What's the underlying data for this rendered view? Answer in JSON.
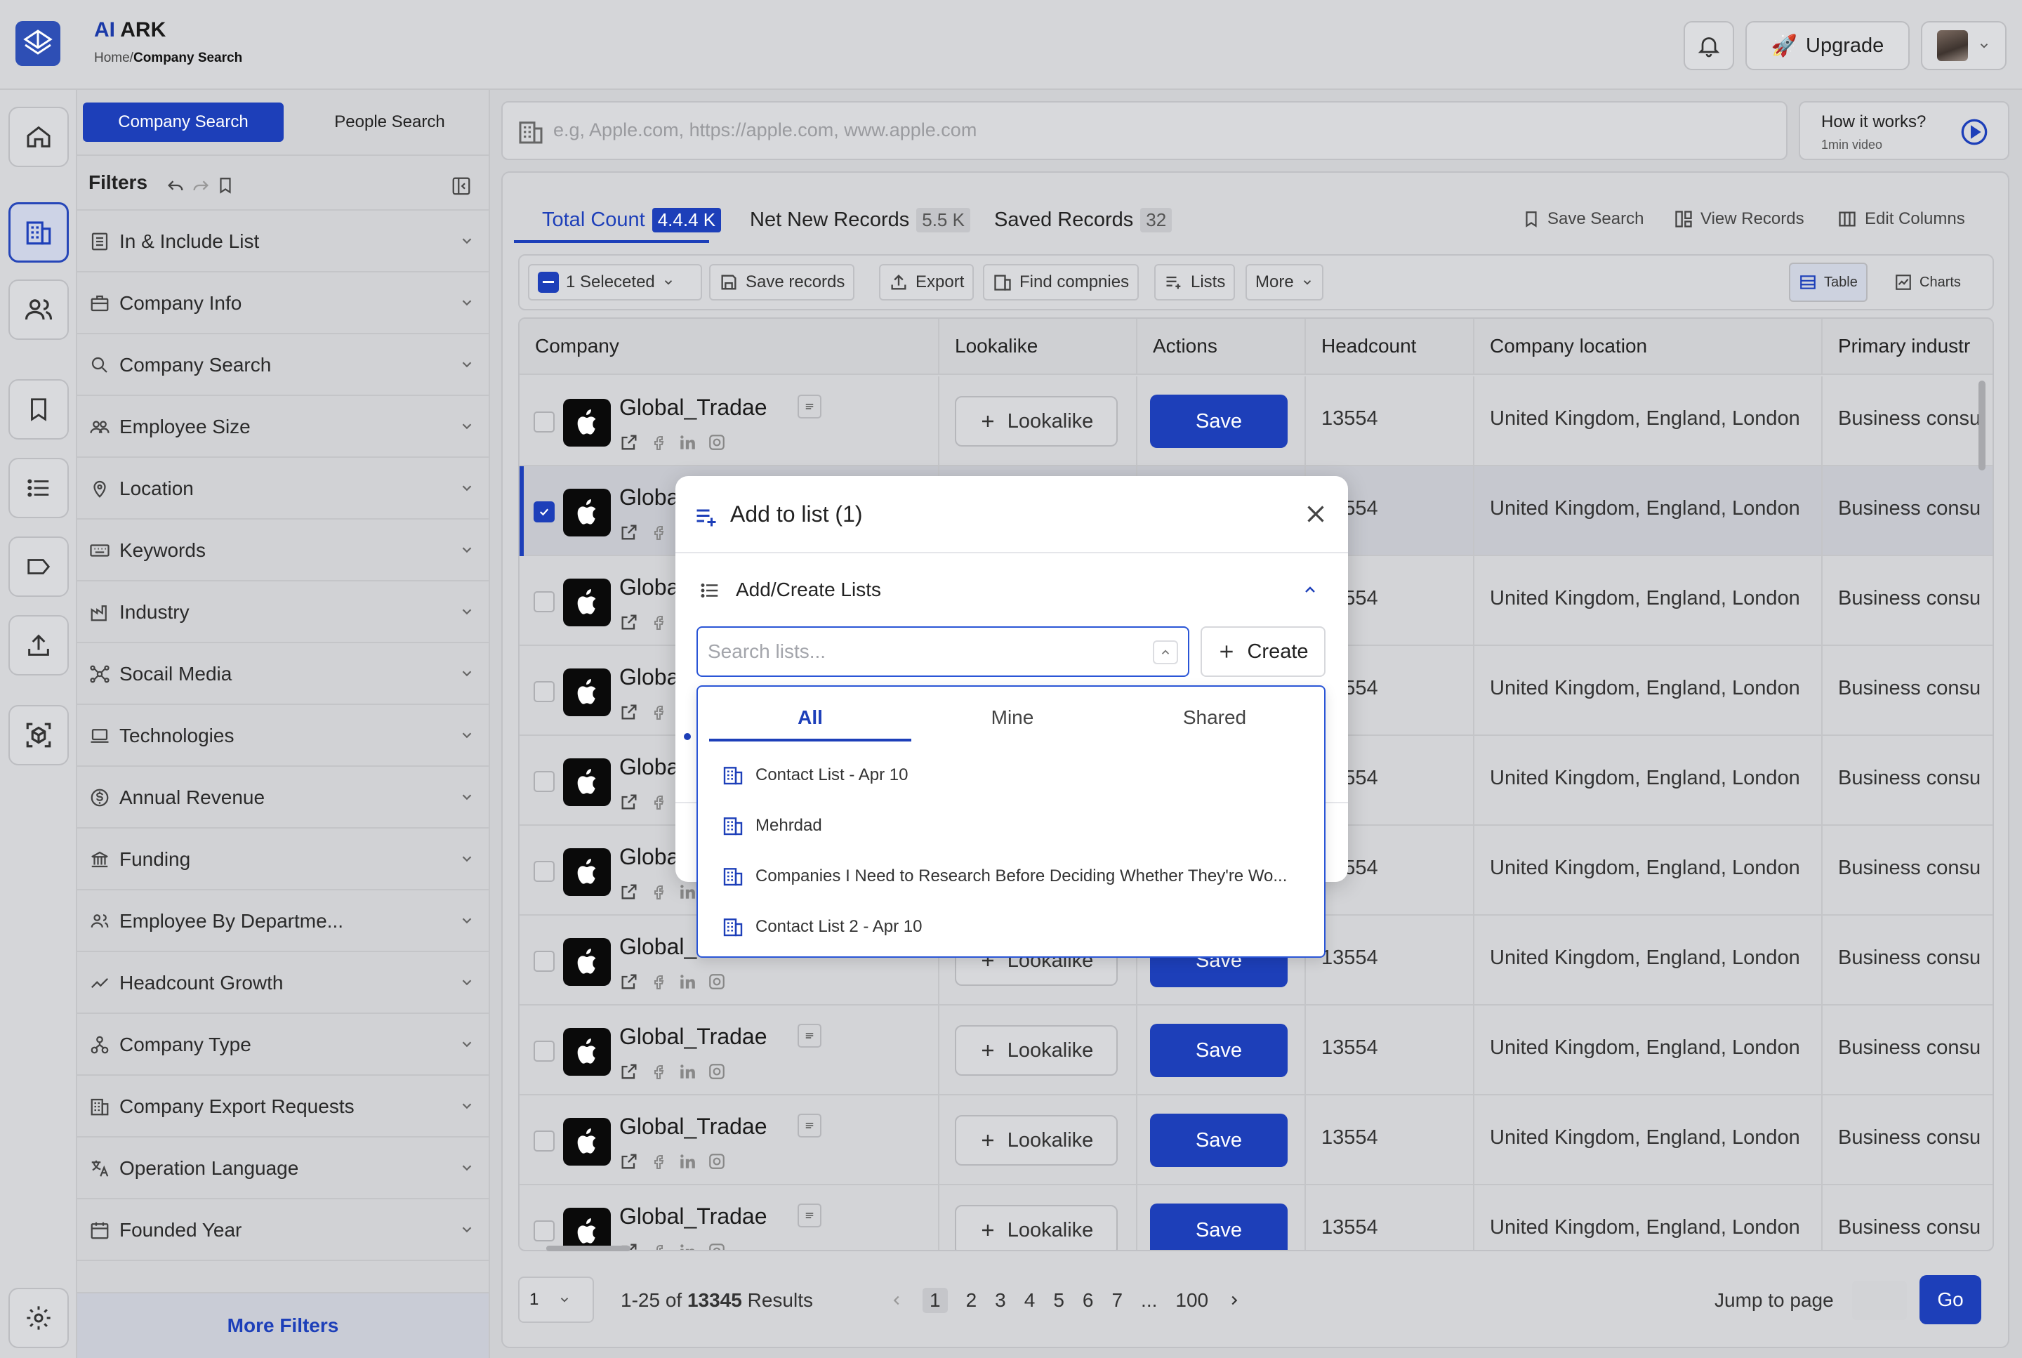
{
  "app": {
    "brand_ai": "AI",
    "brand_rest": "ARK"
  },
  "breadcrumb": {
    "home": "Home/",
    "current": "Company Search"
  },
  "header": {
    "upgrade_label": "Upgrade"
  },
  "search_tabs": {
    "company": "Company Search",
    "people": "People Search"
  },
  "filters": {
    "title": "Filters",
    "items": [
      {
        "label": "In & Include List",
        "icon": "list-icon"
      },
      {
        "label": "Company Info",
        "icon": "briefcase-icon"
      },
      {
        "label": "Company Search",
        "icon": "search-icon"
      },
      {
        "label": "Employee Size",
        "icon": "people-icon"
      },
      {
        "label": "Location",
        "icon": "pin-icon"
      },
      {
        "label": "Keywords",
        "icon": "keyboard-icon"
      },
      {
        "label": "Industry",
        "icon": "factory-icon"
      },
      {
        "label": "Socail Media",
        "icon": "network-icon"
      },
      {
        "label": "Technologies",
        "icon": "laptop-icon"
      },
      {
        "label": "Annual Revenue",
        "icon": "dollar-icon"
      },
      {
        "label": "Funding",
        "icon": "bank-icon"
      },
      {
        "label": "Employee By Departme...",
        "icon": "team-icon"
      },
      {
        "label": "Headcount Growth",
        "icon": "trend-icon"
      },
      {
        "label": "Company Type",
        "icon": "hierarchy-icon"
      },
      {
        "label": "Company Export Requests",
        "icon": "building-icon"
      },
      {
        "label": "Operation Language",
        "icon": "translate-icon"
      },
      {
        "label": "Founded Year",
        "icon": "calendar-icon"
      }
    ],
    "more_label": "More Filters"
  },
  "search": {
    "placeholder": "e.g, Apple.com, https://apple.com, www.apple.com",
    "how_title": "How it works?",
    "how_sub": "1min video"
  },
  "results_tabs": {
    "total_label": "Total Count",
    "total_value": "4.4.4 K",
    "net_label": "Net New Records",
    "net_value": "5.5 K",
    "saved_label": "Saved Records",
    "saved_value": "32"
  },
  "top_actions": {
    "save_search": "Save Search",
    "view_records": "View Records",
    "edit_columns": "Edit Columns"
  },
  "toolbar": {
    "selected": "1 Seleceted",
    "save_records": "Save records",
    "export": "Export",
    "find": "Find compnies",
    "lists": "Lists",
    "more": "More",
    "table": "Table",
    "charts": "Charts"
  },
  "table": {
    "columns": [
      "Company",
      "Lookalike",
      "Actions",
      "Headcount",
      "Company location",
      "Primary industr"
    ],
    "lookalike_label": "Lookalike",
    "save_label": "Save",
    "rows": [
      {
        "name": "Global_Tradae",
        "headcount": "13554",
        "location": "United Kingdom, England, London",
        "industry": "Business consu"
      },
      {
        "name": "Global_Tradae",
        "headcount": "13554",
        "location": "United Kingdom, England, London",
        "industry": "Business consu"
      },
      {
        "name": "Global_Tradae",
        "headcount": "13554",
        "location": "United Kingdom, England, London",
        "industry": "Business consu"
      },
      {
        "name": "Global_Tradae",
        "headcount": "13554",
        "location": "United Kingdom, England, London",
        "industry": "Business consu"
      },
      {
        "name": "Global_Tradae",
        "headcount": "13554",
        "location": "United Kingdom, England, London",
        "industry": "Business consu"
      },
      {
        "name": "Global_Tradae",
        "headcount": "13554",
        "location": "United Kingdom, England, London",
        "industry": "Business consu"
      },
      {
        "name": "Global_Tradae",
        "headcount": "13554",
        "location": "United Kingdom, England, London",
        "industry": "Business consu"
      },
      {
        "name": "Global_Tradae",
        "headcount": "13554",
        "location": "United Kingdom, England, London",
        "industry": "Business consu"
      },
      {
        "name": "Global_Tradae",
        "headcount": "13554",
        "location": "United Kingdom, England, London",
        "industry": "Business consu"
      },
      {
        "name": "Global_Tradae",
        "headcount": "13554",
        "location": "United Kingdom, England, London",
        "industry": "Business consu"
      }
    ]
  },
  "pagination": {
    "per_page": "1",
    "range": "1-25 of ",
    "total": "13345",
    "results_word": " Results",
    "pages": [
      "1",
      "2",
      "3",
      "4",
      "5",
      "6",
      "7",
      "...",
      "100"
    ],
    "jump_label": "Jump to page",
    "go_label": "Go"
  },
  "modal": {
    "title": "Add to list (1)",
    "section_title": "Add/Create Lists",
    "search_placeholder": "Search lists...",
    "create_label": "Create",
    "tabs": [
      "All",
      "Mine",
      "Shared"
    ],
    "lists": [
      "Contact List - Apr 10",
      "Mehrdad",
      "Companies I Need to Research Before Deciding Whether They're Wo...",
      "Contact List 2 - Apr 10"
    ]
  },
  "colors": {
    "brand": "#1d3fb9",
    "accent_border": "#2a55d6"
  }
}
